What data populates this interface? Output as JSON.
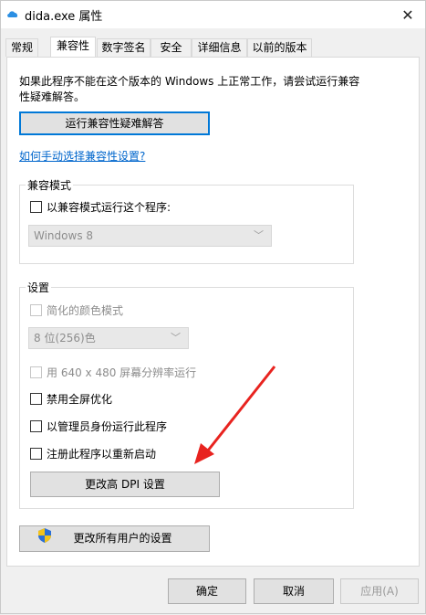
{
  "window": {
    "title": "dida.exe 属性"
  },
  "tabs": [
    {
      "label": "常规"
    },
    {
      "label": "兼容性"
    },
    {
      "label": "数字签名"
    },
    {
      "label": "安全"
    },
    {
      "label": "详细信息"
    },
    {
      "label": "以前的版本"
    }
  ],
  "intro": {
    "text": "如果此程序不能在这个版本的 Windows 上正常工作，请尝试运行兼容性疑难解答。"
  },
  "buttons": {
    "troubleshoot": "运行兼容性疑难解答",
    "change_dpi": "更改高 DPI 设置",
    "change_all_users": "更改所有用户的设置"
  },
  "link": {
    "manual": "如何手动选择兼容性设置?"
  },
  "compat_mode": {
    "group_label": "兼容模式",
    "checkbox_label": "以兼容模式运行这个程序:",
    "select_value": "Windows 8"
  },
  "settings": {
    "group_label": "设置",
    "reduced_color_label": "简化的颜色模式",
    "color_select_value": "8 位(256)色",
    "run_640_label": "用 640 x 480 屏幕分辨率运行",
    "disable_fullscreen_label": "禁用全屏优化",
    "run_admin_label": "以管理员身份运行此程序",
    "register_restart_label": "注册此程序以重新启动"
  },
  "footer": {
    "ok": "确定",
    "cancel": "取消",
    "apply": "应用(A)"
  },
  "colors": {
    "accent": "#0078d7",
    "link": "#0066cc",
    "annotation_arrow": "#e8231f"
  }
}
